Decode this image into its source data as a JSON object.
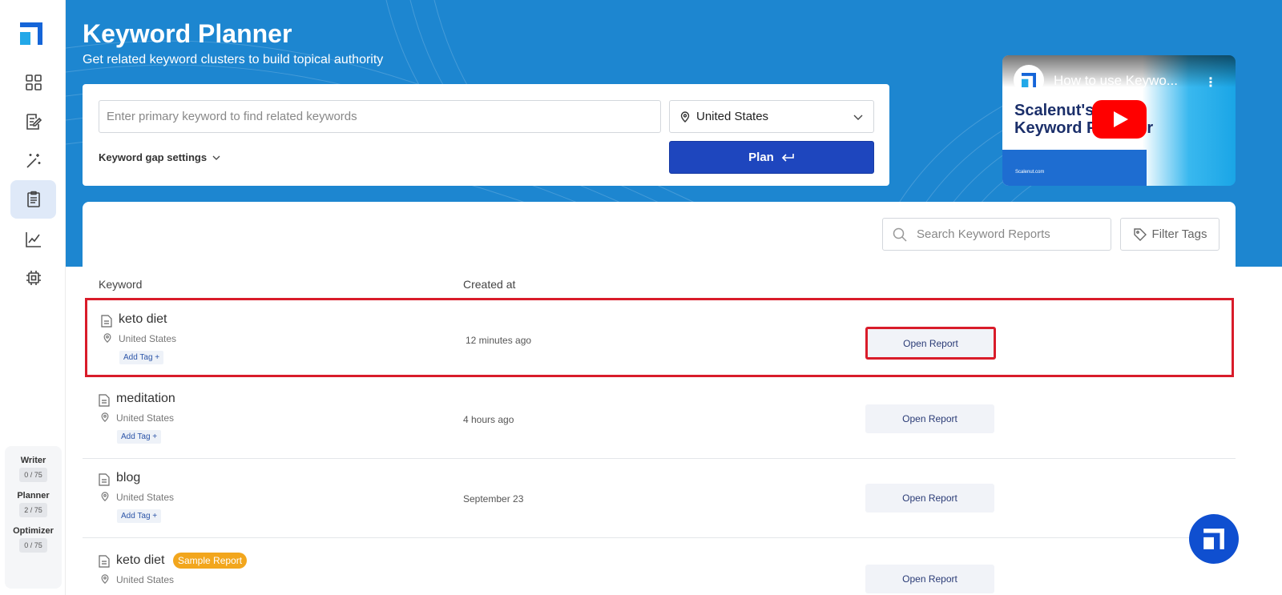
{
  "sidebar": {
    "items": [
      {
        "icon": "grid-icon"
      },
      {
        "icon": "document-edit-icon"
      },
      {
        "icon": "magic-wand-icon"
      },
      {
        "icon": "clipboard-icon",
        "active": true
      },
      {
        "icon": "chart-line-icon"
      },
      {
        "icon": "chip-icon"
      }
    ],
    "usage": [
      {
        "label": "Writer",
        "value": "0 / 75"
      },
      {
        "label": "Planner",
        "value": "2 / 75"
      },
      {
        "label": "Optimizer",
        "value": "0 / 75"
      }
    ]
  },
  "hero": {
    "title": "Keyword Planner",
    "subtitle": "Get related keyword clusters to build topical authority"
  },
  "form": {
    "keyword_placeholder": "Enter primary keyword to find related keywords",
    "keyword_value": "",
    "country": "United States",
    "gap_settings": "Keyword gap settings",
    "plan_label": "Plan"
  },
  "video": {
    "title": "How to use Keywo...",
    "brand_line1": "Scalenut's",
    "brand_line2": "Keyword P",
    "brand_line2_tail": "r",
    "site": "Scalenut.com"
  },
  "reports": {
    "search_placeholder": "Search Keyword Reports",
    "filter_label": "Filter Tags",
    "columns": {
      "keyword": "Keyword",
      "created": "Created at"
    },
    "rows": [
      {
        "keyword": "keto diet",
        "location": "United States",
        "tag": "Add Tag +",
        "created": "12 minutes ago",
        "action": "Open Report",
        "highlighted": true,
        "sample": ""
      },
      {
        "keyword": "meditation",
        "location": "United States",
        "tag": "Add Tag +",
        "created": "4 hours ago",
        "action": "Open Report",
        "highlighted": false,
        "sample": ""
      },
      {
        "keyword": "blog",
        "location": "United States",
        "tag": "Add Tag +",
        "created": "September 23",
        "action": "Open Report",
        "highlighted": false,
        "sample": ""
      },
      {
        "keyword": "keto diet",
        "location": "United States",
        "tag": "",
        "created": "",
        "action": "Open Report",
        "highlighted": false,
        "sample": "Sample Report"
      }
    ]
  },
  "colors": {
    "hero_blue": "#1d86d0",
    "plan_button": "#1e46be",
    "highlight_red": "#d91c2a",
    "sample_badge": "#f2a61d"
  }
}
